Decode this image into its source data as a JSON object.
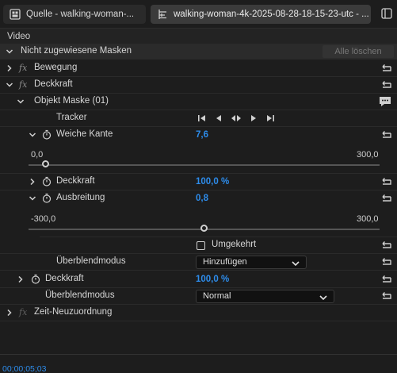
{
  "tabs": [
    {
      "label": "Quelle - walking-woman-...",
      "icon": "clip-icon"
    },
    {
      "label": "walking-woman-4k-2025-08-28-18-15-23-utc - ...",
      "icon": "effect-controls-icon"
    }
  ],
  "section": {
    "title": "Video"
  },
  "unassigned_masks": {
    "label": "Nicht zugewiesene Masken",
    "clear_all": "Alle löschen"
  },
  "effects": {
    "motion": {
      "fx": "fx",
      "label": "Bewegung"
    },
    "opacity": {
      "fx": "fx",
      "label": "Deckkraft"
    },
    "mask": {
      "label": "Objekt Maske (01)"
    },
    "tracker": {
      "label": "Tracker"
    },
    "feather": {
      "label": "Weiche Kante",
      "value": "7,6",
      "min": "0,0",
      "max": "300,0",
      "level": 0.025
    },
    "mask_opacity": {
      "label": "Deckkraft",
      "value": "100,0 %"
    },
    "expansion": {
      "label": "Ausbreitung",
      "value": "0,8",
      "min": "-300,0",
      "max": "300,0",
      "level": 0.501
    },
    "inverted": {
      "label": "Umgekehrt",
      "checked": false
    },
    "mask_blend": {
      "label": "Überblendmodus",
      "value": "Hinzufügen"
    },
    "opacity_value": {
      "label": "Deckkraft",
      "value": "100,0 %"
    },
    "blend": {
      "label": "Überblendmodus",
      "value": "Normal"
    },
    "time_remap": {
      "fx": "fx",
      "label": "Zeit-Neuzuordnung"
    }
  },
  "timecode": "00;00;05;03",
  "colors": {
    "accent": "#2d8ceb",
    "background": "#1d1d1d"
  }
}
